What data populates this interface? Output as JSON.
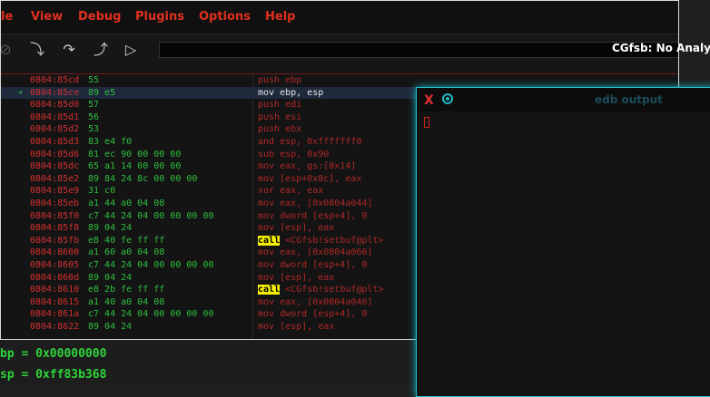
{
  "menu": [
    "le",
    "View",
    "Debug",
    "Plugins",
    "Options",
    "Help"
  ],
  "toolbar": {
    "icons": [
      "stop-icon",
      "step-into-icon",
      "step-over-icon",
      "step-out-icon",
      "run-icon"
    ],
    "plugin_status": "CGfsb: No Analys"
  },
  "disasm": [
    {
      "addr": "0804:85cd",
      "bytes": "55",
      "ins": "push ebp"
    },
    {
      "addr": "0804:85ce",
      "bytes": "89 e5",
      "ins": "mov ebp, esp",
      "current": true
    },
    {
      "addr": "0804:85d0",
      "bytes": "57",
      "ins": "push edi"
    },
    {
      "addr": "0804:85d1",
      "bytes": "56",
      "ins": "push esi"
    },
    {
      "addr": "0804:85d2",
      "bytes": "53",
      "ins": "push ebx"
    },
    {
      "addr": "0804:85d3",
      "bytes": "83 e4 f0",
      "ins": "and esp, 0xfffffff0"
    },
    {
      "addr": "0804:85d6",
      "bytes": "81 ec 90 00 00 00",
      "ins": "sub esp, 0x90"
    },
    {
      "addr": "0804:85dc",
      "bytes": "65 a1 14 00 00 00",
      "ins": "mov eax, gs:[0x14]"
    },
    {
      "addr": "0804:85e2",
      "bytes": "89 84 24 8c 00 00 00",
      "ins": "mov [esp+0x8c], eax"
    },
    {
      "addr": "0804:85e9",
      "bytes": "31 c0",
      "ins": "xor eax, eax"
    },
    {
      "addr": "0804:85eb",
      "bytes": "a1 44 a0 04 08",
      "ins": "mov eax, [0x0804a044]"
    },
    {
      "addr": "0804:85f0",
      "bytes": "c7 44 24 04 00 00 00 00",
      "ins": "mov dword [esp+4], 0"
    },
    {
      "addr": "0804:85f8",
      "bytes": "89 04 24",
      "ins": "mov [esp], eax"
    },
    {
      "addr": "0804:85fb",
      "bytes": "e8 40 fe ff ff",
      "ins_call": "call",
      "ins": " <CGfsb!setbuf@plt>"
    },
    {
      "addr": "0804:8600",
      "bytes": "a1 60 a0 04 08",
      "ins": "mov eax, [0x0804a060]"
    },
    {
      "addr": "0804:8605",
      "bytes": "c7 44 24 04 00 00 00 00",
      "ins": "mov dword [esp+4], 0"
    },
    {
      "addr": "0804:860d",
      "bytes": "89 04 24",
      "ins": "mov [esp], eax"
    },
    {
      "addr": "0804:8610",
      "bytes": "e8 2b fe ff ff",
      "ins_call": "call",
      "ins": " <CGfsb!setbuf@plt>"
    },
    {
      "addr": "0804:8615",
      "bytes": "a1 40 a0 04 08",
      "ins": "mov eax, [0x0804a040]"
    },
    {
      "addr": "0804:861a",
      "bytes": "c7 44 24 04 00 00 00 00",
      "ins": "mov dword [esp+4], 0"
    },
    {
      "addr": "0804:8622",
      "bytes": "89 04 24",
      "ins": "mov [esp], eax"
    }
  ],
  "registers": [
    {
      "text": "bp = 0x00000000"
    },
    {
      "text": "sp = 0xff83b368"
    }
  ],
  "edb_output": {
    "title": "edb output"
  }
}
